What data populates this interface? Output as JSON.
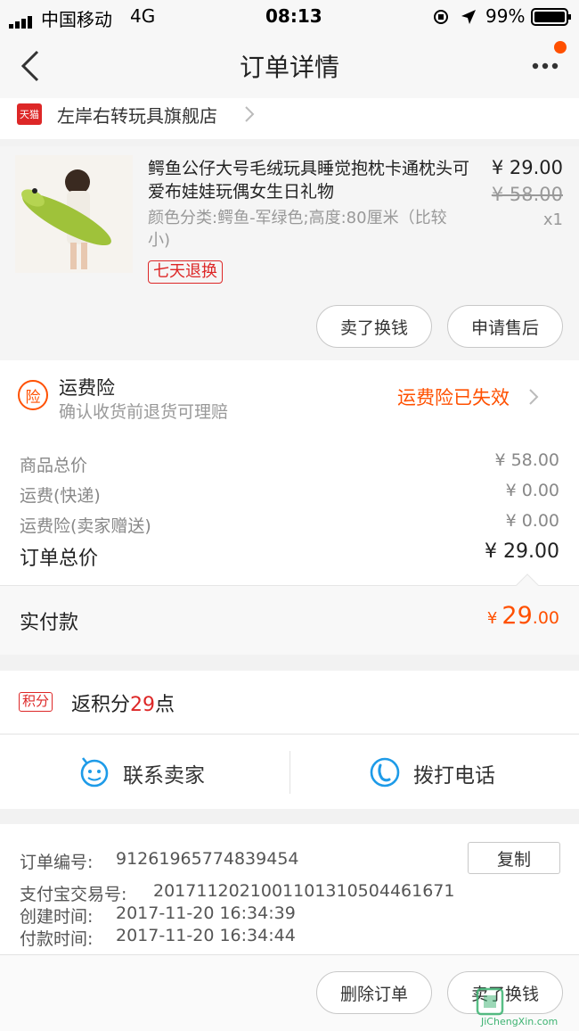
{
  "status_bar": {
    "carrier": "中国移动",
    "network": "4G",
    "time": "08:13",
    "battery": "99%"
  },
  "nav": {
    "title": "订单详情",
    "back_icon": "chevron-left-icon",
    "more_icon": "more-dots-icon",
    "badge_color": "#ff5000"
  },
  "shop": {
    "badge": "天猫",
    "name": "左岸右转玩具旗舰店"
  },
  "product": {
    "title": "鳄鱼公仔大号毛绒玩具睡觉抱枕卡通枕头可爱布娃娃玩偶女生日礼物",
    "sku": "颜色分类:鳄鱼-军绿色;高度:80厘米（比较小)",
    "price": "¥ 29.00",
    "original_price": "¥ 58.00",
    "qty": "x1",
    "tag": "七天退换",
    "btn_sell": "卖了换钱",
    "btn_aftersale": "申请售后"
  },
  "insurance": {
    "icon_char": "险",
    "title": "运费险",
    "subtitle": "确认收货前退货可理赔",
    "status": "运费险已失效"
  },
  "summary": {
    "rows": [
      {
        "label": "商品总价",
        "value": "¥ 58.00"
      },
      {
        "label": "运费(快递)",
        "value": "¥ 0.00"
      },
      {
        "label": "运费险(卖家赠送)",
        "value": "¥ 0.00"
      }
    ],
    "total_label": "订单总价",
    "total_value": "¥ 29.00",
    "paid_label": "实付款",
    "paid_currency": "¥",
    "paid_int": "29",
    "paid_dec": ".00"
  },
  "points": {
    "badge": "积分",
    "prefix": "返积分",
    "value": "29",
    "suffix": "点"
  },
  "contact": {
    "seller": "联系卖家",
    "phone": "拨打电话"
  },
  "order_info": {
    "order_no_label": "订单编号:",
    "order_no": "91261965774839454",
    "copy": "复制",
    "alipay_label": "支付宝交易号:",
    "alipay_no": "2017112021001101310504461671",
    "created_label": "创建时间:",
    "created": "2017-11-20 16:34:39",
    "paid_label": "付款时间:",
    "paid": "2017-11-20 16:34:44"
  },
  "footer": {
    "delete": "删除订单",
    "sell": "卖了换钱"
  },
  "watermark": {
    "text": "JiChengXin.com"
  },
  "colors": {
    "orange": "#ff5000",
    "tmall": "#dd2727",
    "blue": "#1e9be8"
  }
}
